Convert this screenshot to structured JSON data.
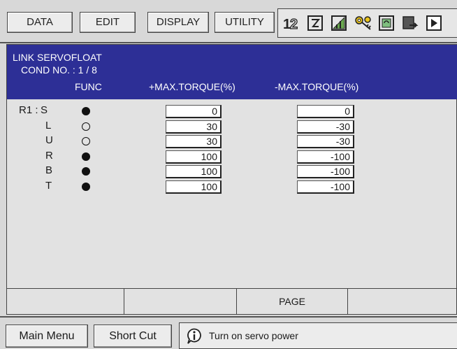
{
  "menu": {
    "items": [
      "DATA",
      "EDIT",
      "DISPLAY",
      "UTILITY"
    ]
  },
  "status_icons": [
    "axis-order-icon",
    "edit-mode-icon",
    "signal-icon",
    "key-icon",
    "cycle-icon",
    "output-icon",
    "play-icon"
  ],
  "panel": {
    "title_line1": "LINK SERVOFLOAT",
    "title_line2": "COND NO. : 1 / 8",
    "col_func": "FUNC",
    "col_pos": "+MAX.TORQUE(%)",
    "col_neg": "-MAX.TORQUE(%)",
    "group_label": "R1 :",
    "rows": [
      {
        "axis": "S",
        "func_on": true,
        "pos": "0",
        "neg": "0"
      },
      {
        "axis": "L",
        "func_on": false,
        "pos": "30",
        "neg": "-30"
      },
      {
        "axis": "U",
        "func_on": false,
        "pos": "30",
        "neg": "-30"
      },
      {
        "axis": "R",
        "func_on": true,
        "pos": "100",
        "neg": "-100"
      },
      {
        "axis": "B",
        "func_on": true,
        "pos": "100",
        "neg": "-100"
      },
      {
        "axis": "T",
        "func_on": true,
        "pos": "100",
        "neg": "-100"
      }
    ]
  },
  "function_keys": [
    "",
    "",
    "PAGE",
    ""
  ],
  "bottom": {
    "main_menu": "Main Menu",
    "short_cut": "Short Cut",
    "message": "Turn on servo power"
  }
}
